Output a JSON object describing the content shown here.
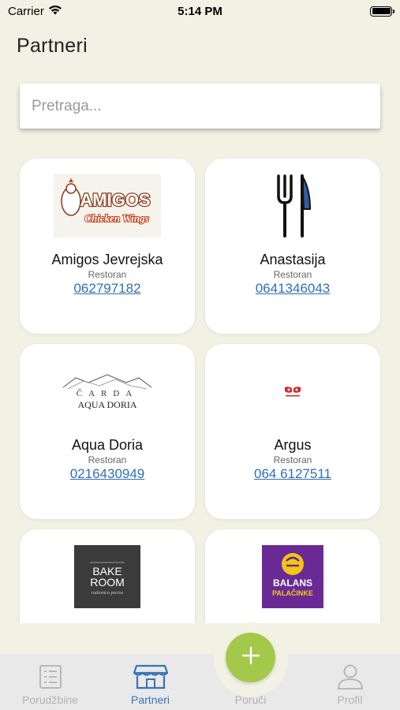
{
  "status_bar": {
    "carrier": "Carrier",
    "time": "5:14 PM"
  },
  "header": {
    "title": "Partneri"
  },
  "search": {
    "placeholder": "Pretraga..."
  },
  "partners": [
    {
      "name": "Amigos Jevrejska",
      "type": "Restoran",
      "phone": "062797182",
      "logo": "amigos-logo",
      "logo_text": "AMIGOS",
      "logo_subtext": "Chicken Wings"
    },
    {
      "name": "Anastasija",
      "type": "Restoran",
      "phone": "0641346043",
      "logo": "fork-knife-icon"
    },
    {
      "name": "Aqua Doria",
      "type": "Restoran",
      "phone": "0216430949",
      "logo": "aqua-doria-logo",
      "logo_text": "ČARDA",
      "logo_subtext": "AQUA DORIA"
    },
    {
      "name": "Argus",
      "type": "Restoran",
      "phone": "064 6127511",
      "logo": "argus-logo"
    },
    {
      "name": "",
      "type": "",
      "phone": "",
      "logo": "bake-room-logo",
      "logo_text": "BAKE ROOM",
      "logo_subtext": "radionica peciva"
    },
    {
      "name": "",
      "type": "",
      "phone": "",
      "logo": "balans-logo",
      "logo_text": "BALANS",
      "logo_subtext": "PALAČINKE"
    }
  ],
  "tabs": [
    {
      "label": "Porudžbine",
      "icon": "list-icon",
      "active": false
    },
    {
      "label": "Partneri",
      "icon": "store-icon",
      "active": true
    },
    {
      "label": "Poruči",
      "icon": "plus-icon",
      "active": false
    },
    {
      "label": "Profil",
      "icon": "person-icon",
      "active": false
    }
  ],
  "colors": {
    "background": "#f1f2e4",
    "accent": "#3a72b8",
    "fab": "#a4c94a",
    "link": "#2f6fba"
  }
}
